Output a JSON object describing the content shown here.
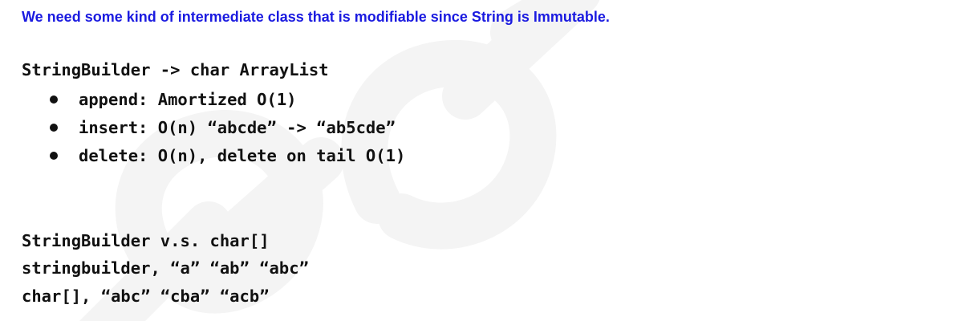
{
  "intro": "We need some kind of intermediate class that is modifiable since String is Immutable.",
  "section1": {
    "heading": "StringBuilder -> char ArrayList",
    "bullets": [
      "append: Amortized O(1)",
      "insert: O(n) “abcde” -> “ab5cde”",
      "delete: O(n), delete on tail O(1)"
    ]
  },
  "section2": {
    "lines": [
      "StringBuilder v.s. char[]",
      "stringbuilder, “a” “ab” “abc”",
      "char[], “abc” “cba” “acb”"
    ]
  }
}
